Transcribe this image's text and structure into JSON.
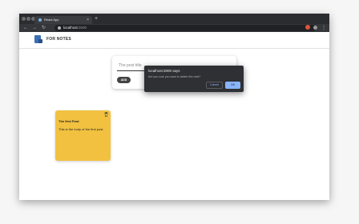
{
  "browser": {
    "tab_title": "React App",
    "tab_close": "×",
    "new_tab": "+",
    "url_host": "localhost",
    "url_port": ":3000",
    "nav_back": "←",
    "nav_forward": "→",
    "nav_reload": "↻",
    "menu": "⋮"
  },
  "app": {
    "brand": "FOR NOTES"
  },
  "form": {
    "title_placeholder": "The post title",
    "add_button": "ADD"
  },
  "notes": [
    {
      "title": "The first Post",
      "body": "This is the body of the first post."
    }
  ],
  "dialog": {
    "title": "localhost:3000 says",
    "message": "Are you sure you want to delete this note?",
    "cancel": "Cancel",
    "ok": "OK"
  },
  "colors": {
    "note": "#f2c140",
    "ok_button": "#8ab4f8",
    "dialog_bg": "#2f3034"
  }
}
